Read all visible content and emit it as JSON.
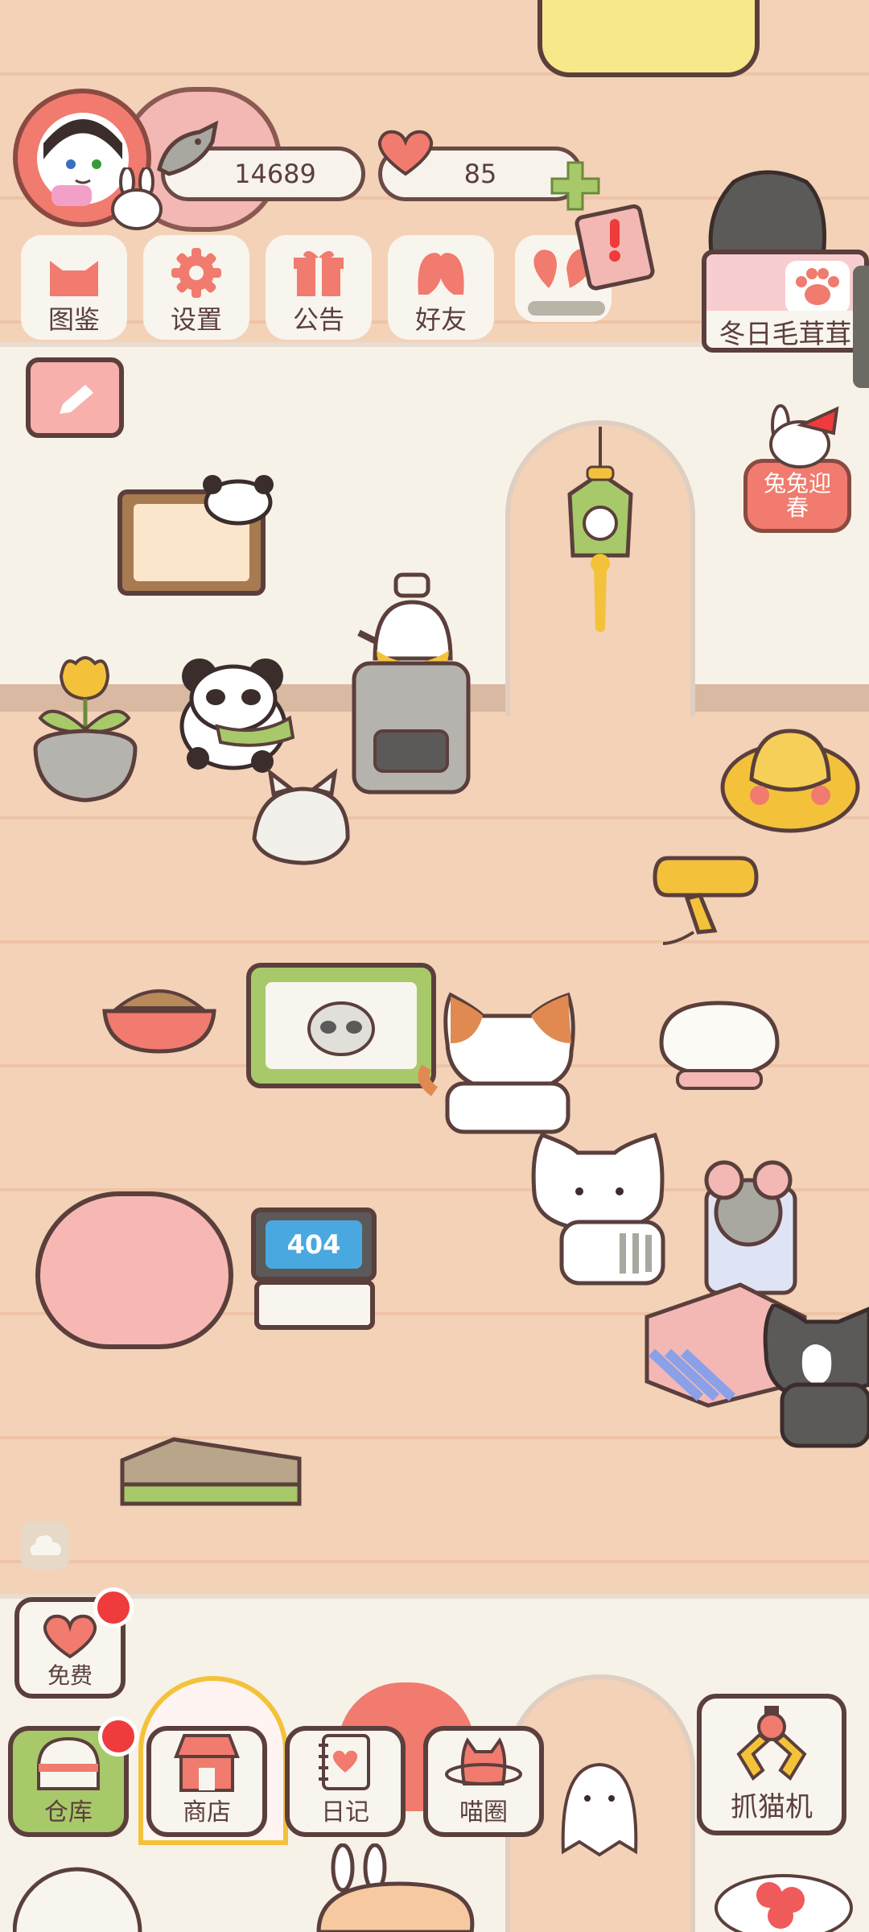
{
  "currency": {
    "fish": {
      "icon": "fish-icon",
      "value": "14689"
    },
    "hearts": {
      "icon": "heart-icon",
      "value": "85",
      "add_icon": "plus-icon"
    }
  },
  "top_menu": [
    {
      "name": "catalog",
      "label": "图鉴",
      "icon": "cat-head-icon"
    },
    {
      "name": "settings",
      "label": "设置",
      "icon": "gear-icon"
    },
    {
      "name": "notice",
      "label": "公告",
      "icon": "gift-icon"
    },
    {
      "name": "friends",
      "label": "好友",
      "icon": "friends-icon"
    }
  ],
  "event_banner": {
    "label": "冬日毛茸茸",
    "icon": "paw-icon"
  },
  "rabbit_event": {
    "label": "兔兔迎春"
  },
  "laptop_screen": "404",
  "free_button": {
    "label": "免费",
    "icon": "heart-icon"
  },
  "bottom_menu": [
    {
      "name": "warehouse",
      "label": "仓库",
      "icon": "chest-icon",
      "badge": true
    },
    {
      "name": "shop",
      "label": "商店",
      "icon": "shop-icon"
    },
    {
      "name": "diary",
      "label": "日记",
      "icon": "diary-icon"
    },
    {
      "name": "circle",
      "label": "喵圈",
      "icon": "cat-planet-icon"
    }
  ],
  "claw_machine": {
    "label": "抓猫机",
    "icon": "claw-icon"
  },
  "colors": {
    "accent": "#f07b6e",
    "outline": "#5b3f3c",
    "green": "#a8c96a",
    "badge": "#ef3b3b"
  }
}
